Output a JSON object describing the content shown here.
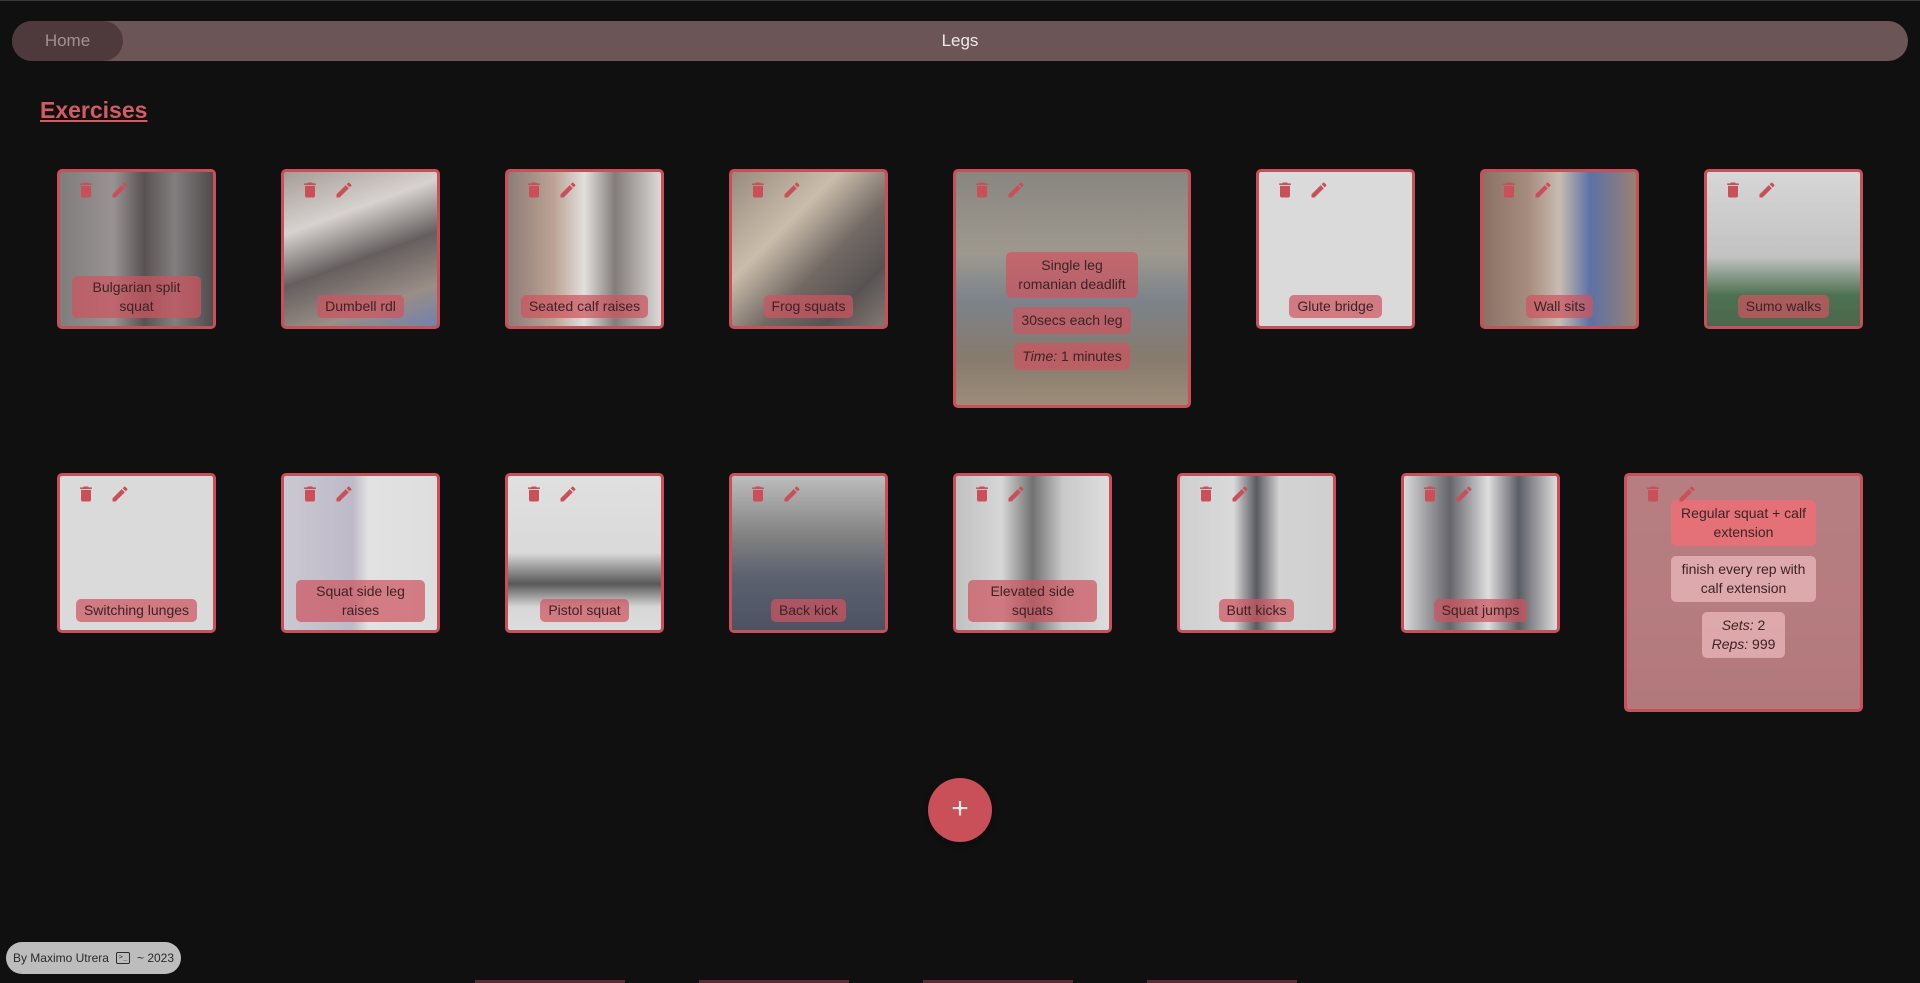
{
  "nav": {
    "home_label": "Home",
    "page_title": "Legs"
  },
  "section_title": "Exercises",
  "accent_color": "#c94f58",
  "icons": {
    "delete": "trash-icon",
    "edit": "pencil-icon",
    "add": "plus-icon",
    "terminal": "terminal-icon"
  },
  "exercises": [
    {
      "name": "Bulgarian split squat"
    },
    {
      "name": "Dumbell rdl"
    },
    {
      "name": "Seated calf raises"
    },
    {
      "name": "Frog squats"
    },
    {
      "name": "Single leg romanian deadlift",
      "description": "30secs each leg",
      "time_label": "Time:",
      "time_value": "1 minutes"
    },
    {
      "name": "Glute bridge"
    },
    {
      "name": "Wall sits"
    },
    {
      "name": "Sumo walks"
    },
    {
      "name": "Switching lunges"
    },
    {
      "name": "Squat side leg raises"
    },
    {
      "name": "Pistol squat"
    },
    {
      "name": "Back kick"
    },
    {
      "name": "Elevated side squats"
    },
    {
      "name": "Butt kicks"
    },
    {
      "name": "Squat jumps"
    },
    {
      "name": "Regular squat + calf extension",
      "description": "finish every rep with calf extension",
      "sets_label": "Sets:",
      "sets_value": "2",
      "reps_label": "Reps:",
      "reps_value": "999"
    }
  ],
  "add_label": "+",
  "footer": {
    "author": "By Maximo Utrera",
    "year": "~ 2023"
  }
}
